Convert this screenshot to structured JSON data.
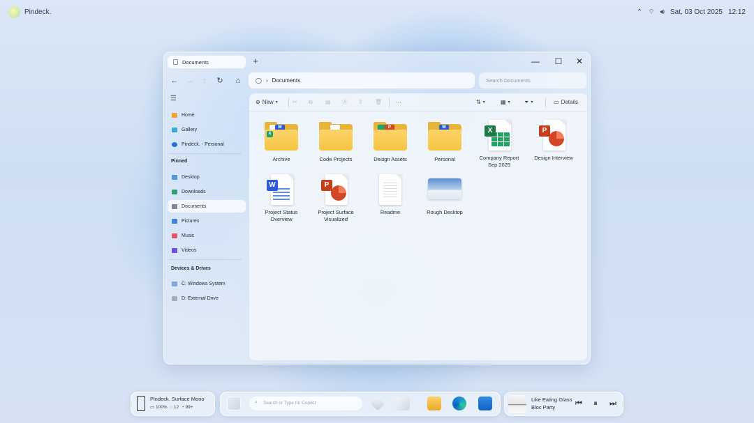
{
  "topbar": {
    "brand": "Pindeck.",
    "datetime": "Sat, 03 Oct 2025",
    "time": "12:12",
    "icons": [
      "chevron-up-icon",
      "wifi-icon",
      "volume-icon"
    ]
  },
  "window": {
    "tab_title": "Documents",
    "new_tab": "+",
    "controls": {
      "minimize": "—",
      "maximize": "☐",
      "close": "✕"
    },
    "nav": {
      "back": "←",
      "forward": "→",
      "up": "↑",
      "refresh": "↻",
      "home": "⌂"
    },
    "address": {
      "path": "Documents",
      "separator": "›"
    },
    "search": {
      "placeholder": "Search Documents"
    }
  },
  "sidebar": {
    "top_items": [
      {
        "label": "Home",
        "icon": "home-icon"
      },
      {
        "label": "Gallery",
        "icon": "gallery-icon"
      },
      {
        "label": "Pindeck. - Personal",
        "icon": "cloud-icon"
      }
    ],
    "pinned_heading": "Pinned",
    "pinned": [
      {
        "label": "Desktop",
        "icon": "desktop-icon"
      },
      {
        "label": "Downloads",
        "icon": "downloads-icon"
      },
      {
        "label": "Documents",
        "icon": "documents-icon",
        "active": true
      },
      {
        "label": "Pictures",
        "icon": "pictures-icon"
      },
      {
        "label": "Music",
        "icon": "music-icon"
      },
      {
        "label": "Videos",
        "icon": "videos-icon"
      }
    ],
    "devices_heading": "Devices & Drives",
    "devices": [
      {
        "label": "C: Windows System",
        "icon": "drive-icon"
      },
      {
        "label": "D: External Drive",
        "icon": "drive-icon"
      }
    ]
  },
  "toolbar": {
    "new_label": "New",
    "sort_icon": "sort-icon",
    "view_icon": "view-icon",
    "filter_icon": "filter-icon",
    "details_label": "Details",
    "more": "···"
  },
  "items": [
    {
      "label": "Archive",
      "type": "folder",
      "paper": "word"
    },
    {
      "label": "Code Projects",
      "type": "folder"
    },
    {
      "label": "Design Assets",
      "type": "folder",
      "paper": "ppt"
    },
    {
      "label": "Personal",
      "type": "folder",
      "paper": "word"
    },
    {
      "label": "Company Report Sep 2025",
      "line1": "Company Report",
      "line2": "Sep 2025",
      "type": "excel"
    },
    {
      "label": "Design Interview",
      "type": "ppt"
    },
    {
      "label": "Project Status Overview",
      "line1": "Project Status",
      "line2": "Overview",
      "type": "word"
    },
    {
      "label": "Project Surface Visualized",
      "line1": "Project Surface",
      "line2": "Visualized",
      "type": "ppt"
    },
    {
      "label": "Readme",
      "type": "text"
    },
    {
      "label": "Rough Desktop",
      "type": "image"
    }
  ],
  "taskbar": {
    "device_name": "Pindeck. Surface Mono",
    "battery": "100%",
    "messages": "12",
    "notifications": "99+",
    "search_placeholder": "Search or Type for Copilot",
    "media_title": "Like Eating Glass",
    "media_artist": "Bloc Party"
  },
  "colors": {
    "folder": "#f6c443",
    "excel": "#21a366",
    "powerpoint": "#d24726",
    "word": "#2b5bd7"
  }
}
